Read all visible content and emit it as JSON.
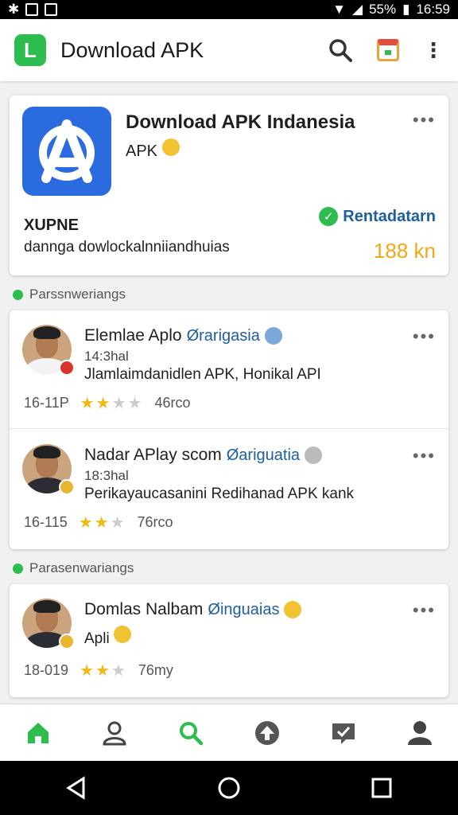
{
  "status_bar": {
    "battery": "55%",
    "time": "16:59"
  },
  "app_bar": {
    "logo_letter": "L",
    "title": "Download APK"
  },
  "hero": {
    "title": "Download APK Indanesia",
    "subtitle": "APK",
    "code": "XUPNE",
    "description": "dannga dowlockalnniiandhuias",
    "verified_label": "Rentadatarn",
    "count": "188 kn"
  },
  "sections": [
    {
      "label": "Parssnweriangs"
    },
    {
      "label": "Parasenwariangs"
    }
  ],
  "reviews": [
    {
      "name": "Elemlae Aplo",
      "tag": "Ørarigasia",
      "time": "14:3hal",
      "text": "Jlamlaimdanidlen APK, Honikal API",
      "id": "16-11P",
      "rating": 1.5,
      "stars": "★★★★",
      "count": "46rco"
    },
    {
      "name": "Nadar APlay scom",
      "tag": "Øariguatia",
      "time": "18:3hal",
      "text": "Perikayaucasanini Redihanad APK kank",
      "id": "16-115",
      "rating": 2,
      "stars": "★★★",
      "count": "76rco"
    },
    {
      "name": "Domlas Nalbam",
      "tag": "Øinguaias",
      "time": "",
      "text": "Apli",
      "id": "18-019",
      "rating": 2,
      "stars": "★★★",
      "count": "76my"
    }
  ],
  "colors": {
    "accent_green": "#2dbd4e",
    "link_blue": "#1e5fa0",
    "star_gold": "#f2b818",
    "count_orange": "#f0a818"
  }
}
